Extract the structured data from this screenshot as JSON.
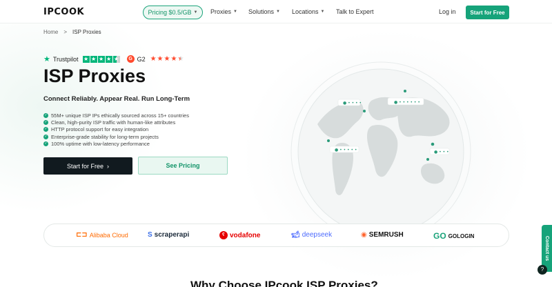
{
  "nav": {
    "logo": "IPCOOK",
    "pricing_label": "Pricing $0.5/GB",
    "items": [
      {
        "label": "Proxies"
      },
      {
        "label": "Solutions"
      },
      {
        "label": "Locations"
      },
      {
        "label": "Talk to Expert"
      }
    ],
    "login_label": "Log in",
    "cta_label": "Start for Free"
  },
  "breadcrumb": {
    "home": "Home",
    "separator": ">",
    "current": "ISP Proxies"
  },
  "ratings": {
    "trustpilot_label": "Trustpilot",
    "trustpilot_stars": 4.5,
    "g2_label": "G2",
    "g2_stars": 4.5
  },
  "hero": {
    "title": "ISP Proxies",
    "subtitle": "Connect Reliably. Appear Real. Run Long-Term",
    "features": [
      "55M+ unique ISP IPs ethically sourced across 15+ countries",
      "Clean, high-purity ISP traffic with human-like attributes",
      "HTTP protocol support for easy integration",
      "Enterprise-grade stability for long-term projects",
      "100% uptime with low-latency performance"
    ],
    "start_label": "Start for Free",
    "pricing_label": "See Pricing"
  },
  "brands": [
    {
      "name": "Alibaba Cloud",
      "icon": "alibaba-icon",
      "color": "#ff6a00"
    },
    {
      "name": "scraperapi",
      "icon": "scraperapi-icon",
      "color": "#1b2a3a"
    },
    {
      "name": "vodafone",
      "icon": "vodafone-icon",
      "color": "#e60000"
    },
    {
      "name": "deepseek",
      "icon": "deepseek-icon",
      "color": "#4d6bfe"
    },
    {
      "name": "SEMRUSH",
      "icon": "semrush-icon",
      "color": "#111111"
    },
    {
      "name": "GOLOGIN",
      "icon": "gologin-icon",
      "color": "#111111"
    }
  ],
  "contact_label": "Contact us",
  "help_label": "?",
  "section_title": "Why Choose IPcook ISP Proxies?",
  "colors": {
    "accent": "#16a37a",
    "dark_button": "#111a1f"
  }
}
